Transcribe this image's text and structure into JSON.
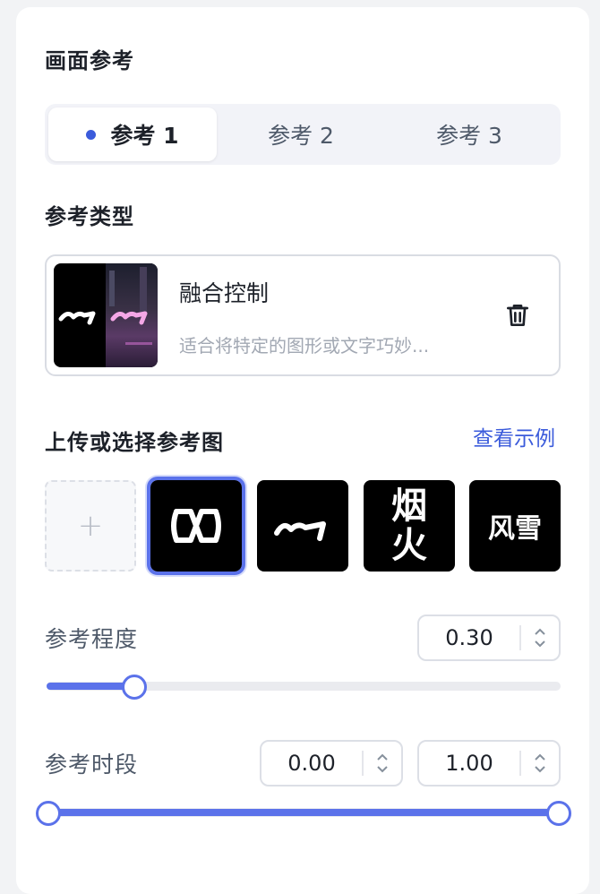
{
  "section": {
    "title": "画面参考",
    "tabs": [
      {
        "label": "参考 1",
        "active": true
      },
      {
        "label": "参考 2",
        "active": false
      },
      {
        "label": "参考 3",
        "active": false
      }
    ]
  },
  "ref_type": {
    "label": "参考类型",
    "card": {
      "title": "融合控制",
      "description": "适合将特定的图形或文字巧妙..."
    }
  },
  "upload": {
    "label": "上传或选择参考图",
    "example_link": "查看示例",
    "add_symbol": "+",
    "tiles": [
      {
        "name": "fusion-logo-icon",
        "selected": true
      },
      {
        "name": "signature-logo-icon",
        "selected": false
      },
      {
        "name": "yanhuo-text",
        "text": "烟火",
        "selected": false
      },
      {
        "name": "fengxue-text",
        "text": "风雪",
        "selected": false
      }
    ]
  },
  "strength": {
    "label": "参考程度",
    "value": "0.30",
    "slider_fraction": 0.15
  },
  "period": {
    "label": "参考时段",
    "start": "0.00",
    "end": "1.00",
    "range_fraction": [
      0.0,
      1.0
    ]
  },
  "colors": {
    "accent": "#5b72ea",
    "tab_dot": "#3b5bdb",
    "link": "#3b5bdb"
  }
}
